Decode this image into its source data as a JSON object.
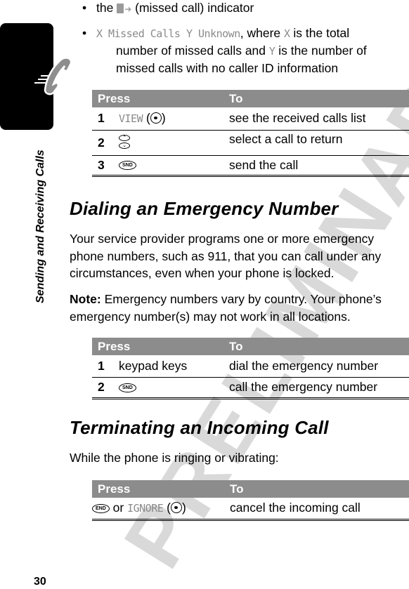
{
  "watermark": "PRELIMINARY",
  "sidebar": {
    "section_title": "Sending and Receiving Calls",
    "icon": "phone-handset-icon"
  },
  "page_number": "30",
  "bullets": [
    {
      "pre": "the",
      "icon": "missed-call-icon",
      "post": "(missed call) indicator"
    },
    {
      "display_text": "X Missed Calls Y Unknown",
      "text_a": ", where ",
      "var_x": "X",
      "text_b": " is the total",
      "line2_a": "number of missed calls and ",
      "var_y": "Y",
      "line2_b": " is the number of",
      "line3": "missed calls with no caller ID information"
    }
  ],
  "table1": {
    "headers": [
      "Press",
      "To"
    ],
    "rows": [
      {
        "num": "1",
        "press_display": "VIEW",
        "press_icon": "left-soft-key-icon",
        "to": "see the received calls list"
      },
      {
        "num": "2",
        "press_icon": "scroll-up-down-icon",
        "to": "select a call to return"
      },
      {
        "num": "3",
        "press_key": "SND",
        "to": "send the call"
      }
    ]
  },
  "section1": {
    "heading": "Dialing an Emergency Number",
    "paragraph": "Your service provider programs one or more emergency phone numbers, such as 911, that you can call under any circumstances, even when your phone is locked.",
    "note_label": "Note:",
    "note_text": " Emergency numbers vary by country. Your phone’s emergency number(s) may not work in all locations."
  },
  "table2": {
    "headers": [
      "Press",
      "To"
    ],
    "rows": [
      {
        "num": "1",
        "press": "keypad keys",
        "to": "dial the emergency number"
      },
      {
        "num": "2",
        "press_key": "SND",
        "to": "call the emergency number"
      }
    ]
  },
  "section2": {
    "heading": "Terminating an Incoming Call",
    "paragraph": "While the phone is ringing or vibrating:"
  },
  "table3": {
    "headers": [
      "Press",
      "To"
    ],
    "rows": [
      {
        "press_key": "END",
        "press_or": "or",
        "press_display": "IGNORE",
        "press_icon": "right-soft-key-icon",
        "to": "cancel the incoming call"
      }
    ]
  }
}
